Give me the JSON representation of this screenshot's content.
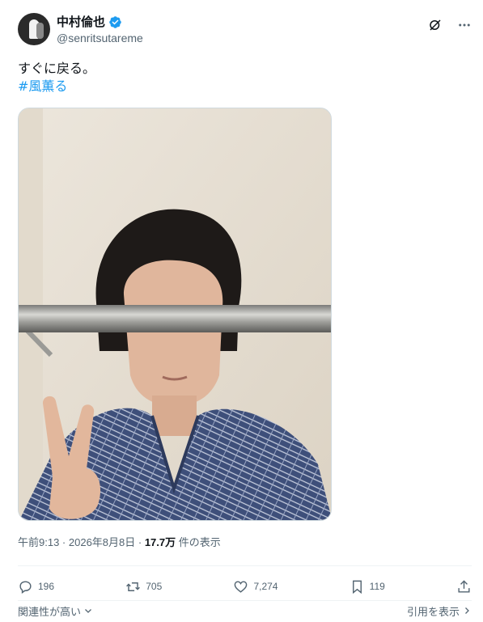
{
  "author": {
    "display_name": "中村倫也",
    "handle": "@senritsutareme",
    "verified": true
  },
  "tweet": {
    "text": "すぐに戻る。",
    "hashtag": "#風薫る"
  },
  "meta": {
    "time": "午前9:13",
    "separator1": " · ",
    "date": "2026年8月8日",
    "separator2": " · ",
    "views_count": "17.7万",
    "views_label": " 件の表示"
  },
  "actions": {
    "replies": "196",
    "reposts": "705",
    "likes": "7,274",
    "bookmarks": "119"
  },
  "footer": {
    "sort_label": "関連性が高い",
    "quotes_label": "引用を表示"
  },
  "colors": {
    "accent": "#1d9bf0",
    "text": "#0f1419",
    "secondary": "#536471"
  }
}
